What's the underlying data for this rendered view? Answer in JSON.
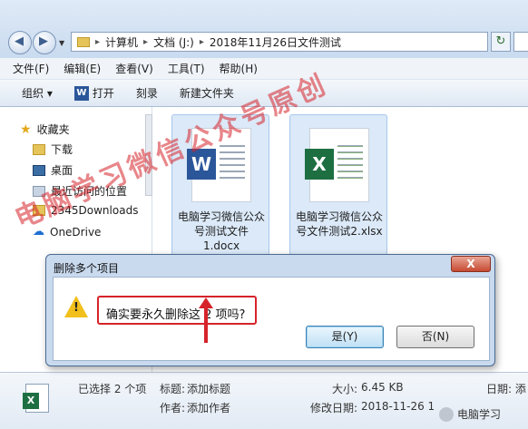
{
  "address": {
    "crumbs": [
      "计算机",
      "文档 (J:)",
      "2018年11月26日文件测试"
    ]
  },
  "menu": [
    "文件(F)",
    "编辑(E)",
    "查看(V)",
    "工具(T)",
    "帮助(H)"
  ],
  "toolbar": {
    "organize": "组织 ▾",
    "open": "打开",
    "burn": "刻录",
    "new_folder": "新建文件夹"
  },
  "sidebar": {
    "favorites": "收藏夹",
    "items": [
      "下载",
      "桌面",
      "最近访问的位置",
      "2345Downloads",
      "OneDrive"
    ]
  },
  "files": [
    {
      "name": "电脑学习微信公众号测试文件1.docx",
      "type": "word"
    },
    {
      "name": "电脑学习微信公众号文件测试2.xlsx",
      "type": "excel"
    }
  ],
  "details": {
    "selected": "已选择 2 个项",
    "title_k": "标题:",
    "title_v": "添加标题",
    "author_k": "作者:",
    "author_v": "添加作者",
    "size_k": "大小:",
    "size_v": "6.45 KB",
    "modified_k": "修改日期:",
    "modified_v": "2018-11-26 1",
    "right_k": "日期: 添"
  },
  "dialog": {
    "title": "删除多个项目",
    "close": "X",
    "message": "确实要永久删除这 2 项吗?",
    "yes": "是(Y)",
    "no": "否(N)"
  },
  "watermark": "电脑学习微信公众号原创",
  "footer_brand": "电脑学习"
}
